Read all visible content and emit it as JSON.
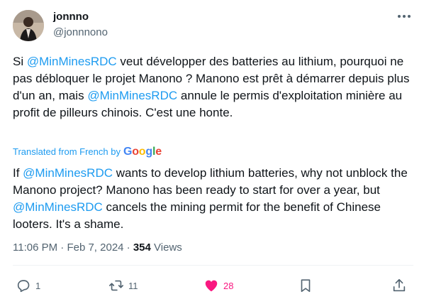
{
  "author": {
    "display_name": "jonnno",
    "handle": "@jonnnono"
  },
  "tweet": {
    "original": [
      {
        "t": "Si "
      },
      {
        "t": "@MinMinesRDC",
        "mention": true
      },
      {
        "t": " veut développer des batteries au lithium, pourquoi ne pas débloquer le projet Manono ? Manono est prêt à démarrer depuis plus d'un an, mais "
      },
      {
        "t": "@MinMinesRDC",
        "mention": true
      },
      {
        "t": " annule le permis d'exploitation minière au profit de pilleurs chinois. C'est une honte."
      }
    ],
    "translation_label": "Translated from French by",
    "translation_provider": "Google",
    "translated": [
      {
        "t": "If "
      },
      {
        "t": "@MinMinesRDC",
        "mention": true
      },
      {
        "t": " wants to develop lithium batteries, why not unblock the Manono project? Manono has been ready to start for over a year, but "
      },
      {
        "t": "@MinMinesRDC",
        "mention": true
      },
      {
        "t": " cancels the mining permit for the benefit of Chinese looters. It's a shame."
      }
    ],
    "time": "11:06 PM",
    "separator": "·",
    "date": "Feb 7, 2024",
    "views_count": "354",
    "views_label": "Views"
  },
  "actions": {
    "replies": "1",
    "reposts": "11",
    "likes": "28"
  },
  "colors": {
    "mention": "#1d9bf0",
    "like_active": "#f91880",
    "muted": "#536471"
  }
}
